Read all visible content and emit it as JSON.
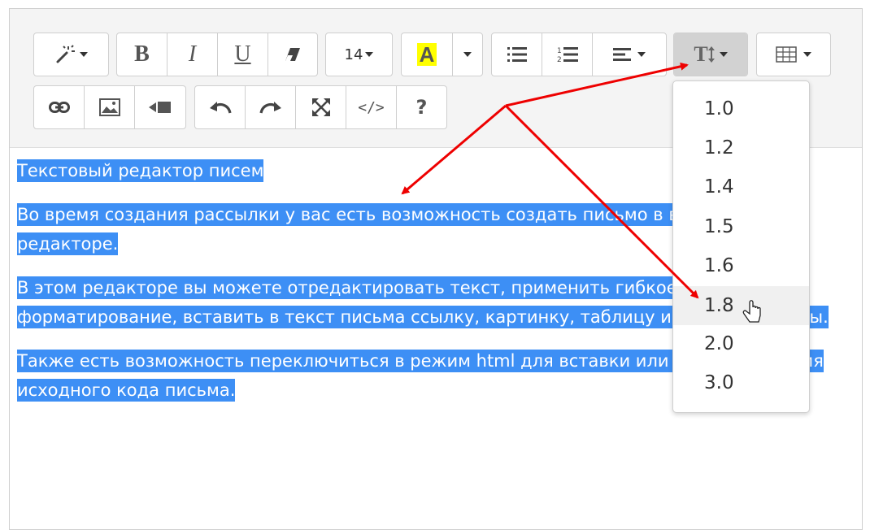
{
  "toolbar": {
    "font_size_value": "14",
    "highlight_letter": "A",
    "highlight_color": "#ffff00",
    "bold_label": "B",
    "italic_label": "I",
    "underline_label": "U",
    "code_label": "</>",
    "help_label": "?",
    "line_height_label": "T",
    "icons": [
      "magic-wand-icon",
      "bold-icon",
      "italic-icon",
      "underline-icon",
      "eraser-icon",
      "highlight-icon",
      "bullet-list-icon",
      "numbered-list-icon",
      "align-icon",
      "line-height-icon",
      "table-icon",
      "link-icon",
      "image-icon",
      "video-icon",
      "undo-icon",
      "redo-icon",
      "fullscreen-icon",
      "code-icon",
      "help-icon"
    ]
  },
  "content": {
    "paragraphs": [
      "Текстовый редактор писем ",
      "Во время создания рассылки у вас есть возможность создать письмо в визуальном редакторе. ",
      "В этом редакторе вы можете отредактировать текст, применить гибкое форматирование, вставить в текст письма ссылку, картинку, таблицу и другие объекты.",
      "Также есть возможность переключиться в режим html для вставки или редактирования исходного кода письма."
    ],
    "selection_color": "#3d8ff5"
  },
  "line_height_dropdown": {
    "options": [
      "1.0",
      "1.2",
      "1.4",
      "1.5",
      "1.6",
      "1.8",
      "2.0",
      "3.0"
    ],
    "hovered": "1.8"
  },
  "annotation_color": "#ee0000"
}
